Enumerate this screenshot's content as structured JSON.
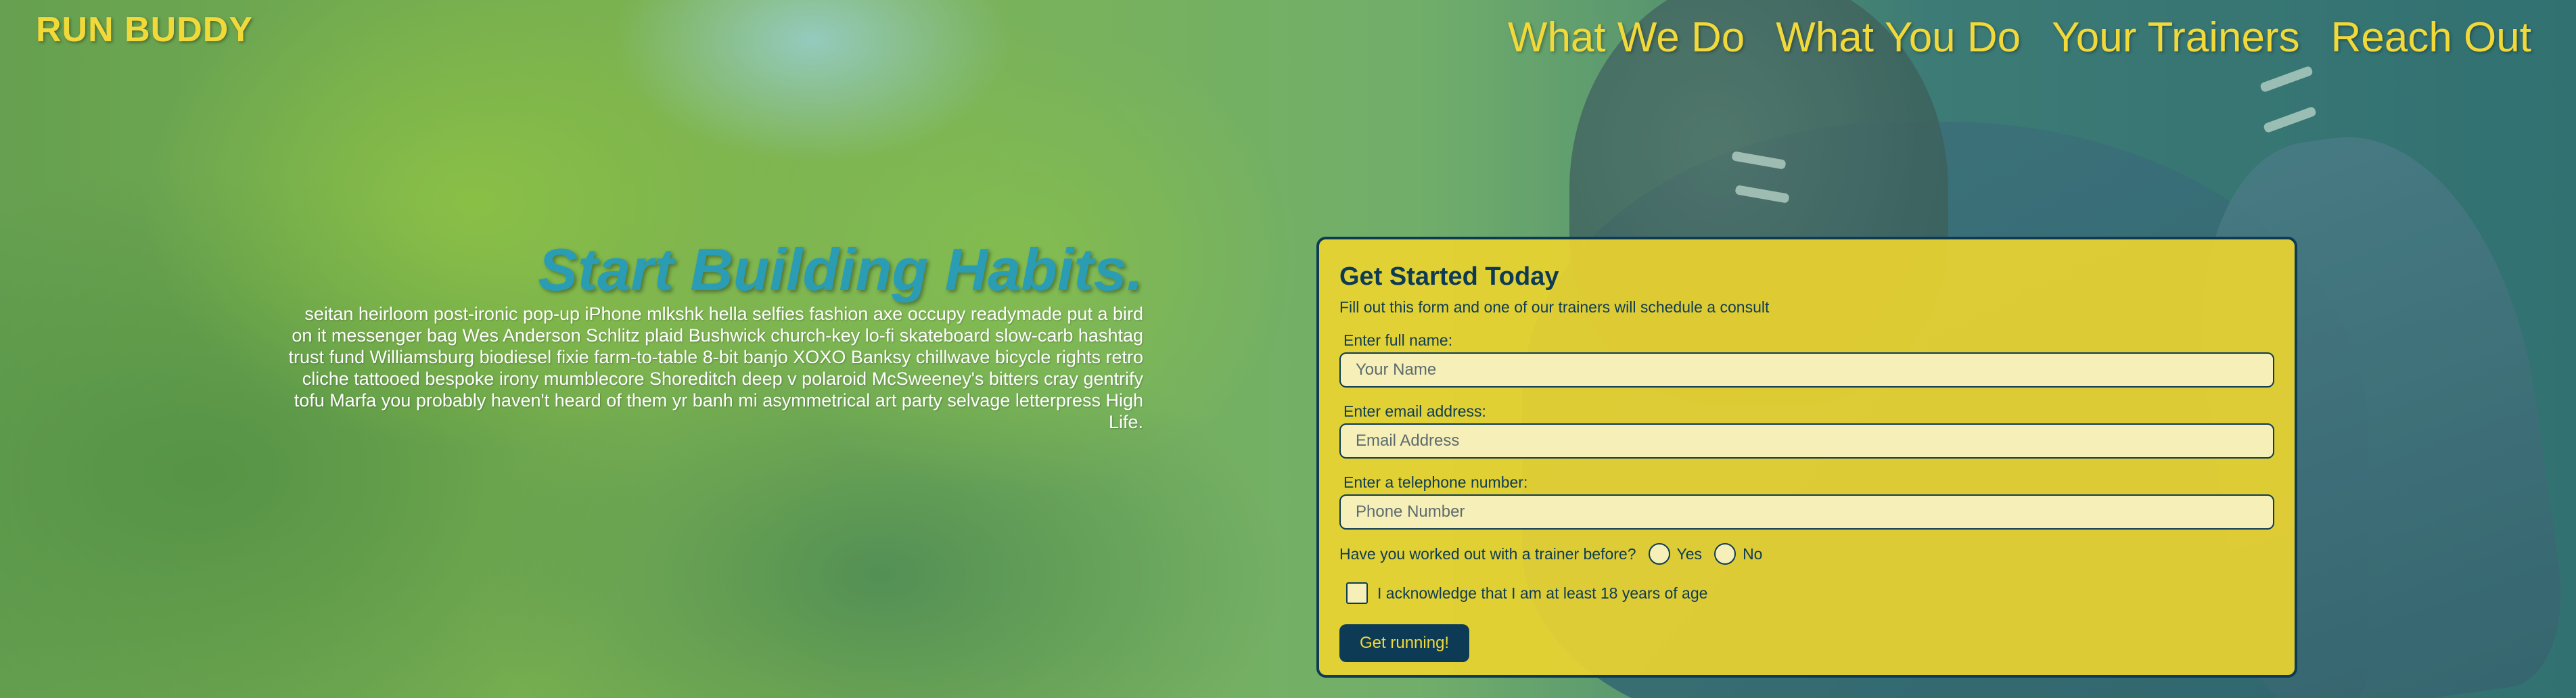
{
  "brand": {
    "name": "RUN BUDDY"
  },
  "nav": {
    "items": [
      {
        "label": "What We Do"
      },
      {
        "label": "What You Do"
      },
      {
        "label": "Your Trainers"
      },
      {
        "label": "Reach Out"
      }
    ]
  },
  "hero": {
    "headline": "Start Building Habits.",
    "blurb": "seitan heirloom post-ironic pop-up iPhone mlkshk hella selfies fashion axe occupy readymade put a bird on it messenger bag Wes Anderson Schlitz plaid Bushwick church-key lo-fi skateboard slow-carb hashtag trust fund Williamsburg biodiesel fixie farm-to-table 8-bit banjo XOXO Banksy chillwave bicycle rights retro cliche tattooed bespoke irony mumblecore Shoreditch deep v polaroid McSweeney's bitters cray gentrify tofu Marfa you probably haven't heard of them yr banh mi asymmetrical art party selvage letterpress High Life."
  },
  "form": {
    "title": "Get Started Today",
    "subtitle": "Fill out this form and one of our trainers will schedule a consult",
    "name_label": "Enter full name:",
    "name_placeholder": "Your Name",
    "email_label": "Enter email address:",
    "email_placeholder": "Email Address",
    "phone_label": "Enter a telephone number:",
    "phone_placeholder": "Phone Number",
    "trainer_question": "Have you worked out with a trainer before?",
    "yes_label": "Yes",
    "no_label": "No",
    "age_ack": "I acknowledge that I am at least 18 years of age",
    "submit_label": "Get running!"
  },
  "colors": {
    "accent_yellow": "#f2d93a",
    "navy": "#0d3b55",
    "headline_teal": "#2a9db5",
    "form_bg": "#ecd430"
  }
}
